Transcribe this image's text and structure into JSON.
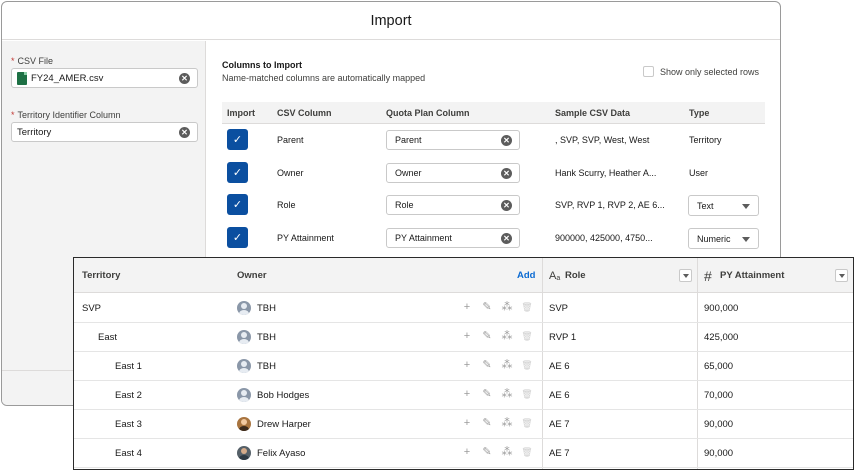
{
  "modal": {
    "title": "Import",
    "csv_file": {
      "label": "CSV File",
      "required_mark": "*",
      "value": "FY24_AMER.csv",
      "file_icon": "xls-icon"
    },
    "territory_identifier": {
      "label": "Territory Identifier Column",
      "required_mark": "*",
      "value": "Territory"
    },
    "columns_title": "Columns to Import",
    "columns_subtitle": "Name-matched columns are automatically mapped",
    "show_selected_label": "Show only selected rows",
    "headers": {
      "import": "Import",
      "csv_column": "CSV Column",
      "quota_plan_column": "Quota Plan Column",
      "sample": "Sample CSV Data",
      "type": "Type"
    },
    "rows": [
      {
        "csv": "Parent",
        "quota": "Parent",
        "sample": ", SVP, SVP, West, West",
        "type": "Territory"
      },
      {
        "csv": "Owner",
        "quota": "Owner",
        "sample": "Hank Scurry, Heather A...",
        "type": "User"
      },
      {
        "csv": "Role",
        "quota": "Role",
        "sample": "SVP, RVP 1, RVP 2, AE 6...",
        "type": "Text"
      },
      {
        "csv": "PY Attainment",
        "quota": "PY Attainment",
        "sample": "900000, 425000, 4750...",
        "type": "Numeric"
      }
    ]
  },
  "grid": {
    "headers": {
      "territory": "Territory",
      "owner": "Owner",
      "add": "Add",
      "role_icon": "A",
      "role_icon_sub": "a",
      "role": "Role",
      "pya_icon": "#",
      "pya": "PY Attainment"
    },
    "row_action_icons": [
      "plus-icon",
      "pencil-icon",
      "magic-wand-icon",
      "trash-icon"
    ],
    "rows": [
      {
        "territory": "SVP",
        "indent": 0,
        "owner": "TBH",
        "avatar": "placeholder",
        "role": "SVP",
        "py_attainment": "900,000"
      },
      {
        "territory": "East",
        "indent": 1,
        "owner": "TBH",
        "avatar": "placeholder",
        "role": "RVP 1",
        "py_attainment": "425,000"
      },
      {
        "territory": "East 1",
        "indent": 2,
        "owner": "TBH",
        "avatar": "placeholder",
        "role": "AE 6",
        "py_attainment": "65,000"
      },
      {
        "territory": "East 2",
        "indent": 2,
        "owner": "Bob Hodges",
        "avatar": "placeholder",
        "role": "AE 6",
        "py_attainment": "70,000"
      },
      {
        "territory": "East 3",
        "indent": 2,
        "owner": "Drew Harper",
        "avatar": "photo",
        "role": "AE 7",
        "py_attainment": "90,000"
      },
      {
        "territory": "East 4",
        "indent": 2,
        "owner": "Felix Ayaso",
        "avatar": "photo",
        "role": "AE 7",
        "py_attainment": "90,000"
      }
    ]
  }
}
